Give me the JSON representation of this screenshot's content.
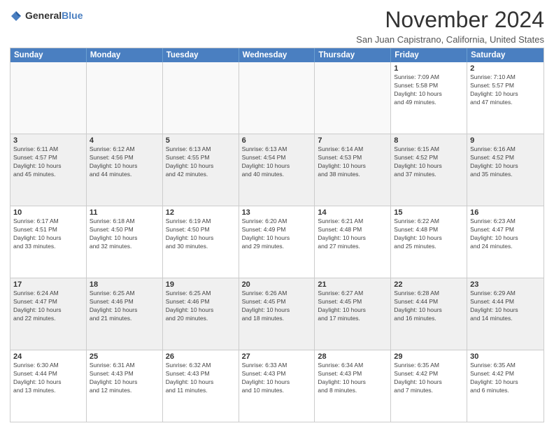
{
  "header": {
    "logo_general": "General",
    "logo_blue": "Blue",
    "title": "November 2024",
    "subtitle": "San Juan Capistrano, California, United States"
  },
  "calendar": {
    "days_of_week": [
      "Sunday",
      "Monday",
      "Tuesday",
      "Wednesday",
      "Thursday",
      "Friday",
      "Saturday"
    ],
    "weeks": [
      [
        {
          "day": "",
          "info": "",
          "empty": true
        },
        {
          "day": "",
          "info": "",
          "empty": true
        },
        {
          "day": "",
          "info": "",
          "empty": true
        },
        {
          "day": "",
          "info": "",
          "empty": true
        },
        {
          "day": "",
          "info": "",
          "empty": true
        },
        {
          "day": "1",
          "info": "Sunrise: 7:09 AM\nSunset: 5:58 PM\nDaylight: 10 hours\nand 49 minutes."
        },
        {
          "day": "2",
          "info": "Sunrise: 7:10 AM\nSunset: 5:57 PM\nDaylight: 10 hours\nand 47 minutes."
        }
      ],
      [
        {
          "day": "3",
          "info": "Sunrise: 6:11 AM\nSunset: 4:57 PM\nDaylight: 10 hours\nand 45 minutes.",
          "shaded": true
        },
        {
          "day": "4",
          "info": "Sunrise: 6:12 AM\nSunset: 4:56 PM\nDaylight: 10 hours\nand 44 minutes.",
          "shaded": true
        },
        {
          "day": "5",
          "info": "Sunrise: 6:13 AM\nSunset: 4:55 PM\nDaylight: 10 hours\nand 42 minutes.",
          "shaded": true
        },
        {
          "day": "6",
          "info": "Sunrise: 6:13 AM\nSunset: 4:54 PM\nDaylight: 10 hours\nand 40 minutes.",
          "shaded": true
        },
        {
          "day": "7",
          "info": "Sunrise: 6:14 AM\nSunset: 4:53 PM\nDaylight: 10 hours\nand 38 minutes.",
          "shaded": true
        },
        {
          "day": "8",
          "info": "Sunrise: 6:15 AM\nSunset: 4:52 PM\nDaylight: 10 hours\nand 37 minutes.",
          "shaded": true
        },
        {
          "day": "9",
          "info": "Sunrise: 6:16 AM\nSunset: 4:52 PM\nDaylight: 10 hours\nand 35 minutes.",
          "shaded": true
        }
      ],
      [
        {
          "day": "10",
          "info": "Sunrise: 6:17 AM\nSunset: 4:51 PM\nDaylight: 10 hours\nand 33 minutes."
        },
        {
          "day": "11",
          "info": "Sunrise: 6:18 AM\nSunset: 4:50 PM\nDaylight: 10 hours\nand 32 minutes."
        },
        {
          "day": "12",
          "info": "Sunrise: 6:19 AM\nSunset: 4:50 PM\nDaylight: 10 hours\nand 30 minutes."
        },
        {
          "day": "13",
          "info": "Sunrise: 6:20 AM\nSunset: 4:49 PM\nDaylight: 10 hours\nand 29 minutes."
        },
        {
          "day": "14",
          "info": "Sunrise: 6:21 AM\nSunset: 4:48 PM\nDaylight: 10 hours\nand 27 minutes."
        },
        {
          "day": "15",
          "info": "Sunrise: 6:22 AM\nSunset: 4:48 PM\nDaylight: 10 hours\nand 25 minutes."
        },
        {
          "day": "16",
          "info": "Sunrise: 6:23 AM\nSunset: 4:47 PM\nDaylight: 10 hours\nand 24 minutes."
        }
      ],
      [
        {
          "day": "17",
          "info": "Sunrise: 6:24 AM\nSunset: 4:47 PM\nDaylight: 10 hours\nand 22 minutes.",
          "shaded": true
        },
        {
          "day": "18",
          "info": "Sunrise: 6:25 AM\nSunset: 4:46 PM\nDaylight: 10 hours\nand 21 minutes.",
          "shaded": true
        },
        {
          "day": "19",
          "info": "Sunrise: 6:25 AM\nSunset: 4:46 PM\nDaylight: 10 hours\nand 20 minutes.",
          "shaded": true
        },
        {
          "day": "20",
          "info": "Sunrise: 6:26 AM\nSunset: 4:45 PM\nDaylight: 10 hours\nand 18 minutes.",
          "shaded": true
        },
        {
          "day": "21",
          "info": "Sunrise: 6:27 AM\nSunset: 4:45 PM\nDaylight: 10 hours\nand 17 minutes.",
          "shaded": true
        },
        {
          "day": "22",
          "info": "Sunrise: 6:28 AM\nSunset: 4:44 PM\nDaylight: 10 hours\nand 16 minutes.",
          "shaded": true
        },
        {
          "day": "23",
          "info": "Sunrise: 6:29 AM\nSunset: 4:44 PM\nDaylight: 10 hours\nand 14 minutes.",
          "shaded": true
        }
      ],
      [
        {
          "day": "24",
          "info": "Sunrise: 6:30 AM\nSunset: 4:44 PM\nDaylight: 10 hours\nand 13 minutes."
        },
        {
          "day": "25",
          "info": "Sunrise: 6:31 AM\nSunset: 4:43 PM\nDaylight: 10 hours\nand 12 minutes."
        },
        {
          "day": "26",
          "info": "Sunrise: 6:32 AM\nSunset: 4:43 PM\nDaylight: 10 hours\nand 11 minutes."
        },
        {
          "day": "27",
          "info": "Sunrise: 6:33 AM\nSunset: 4:43 PM\nDaylight: 10 hours\nand 10 minutes."
        },
        {
          "day": "28",
          "info": "Sunrise: 6:34 AM\nSunset: 4:43 PM\nDaylight: 10 hours\nand 8 minutes."
        },
        {
          "day": "29",
          "info": "Sunrise: 6:35 AM\nSunset: 4:42 PM\nDaylight: 10 hours\nand 7 minutes."
        },
        {
          "day": "30",
          "info": "Sunrise: 6:35 AM\nSunset: 4:42 PM\nDaylight: 10 hours\nand 6 minutes."
        }
      ]
    ]
  }
}
